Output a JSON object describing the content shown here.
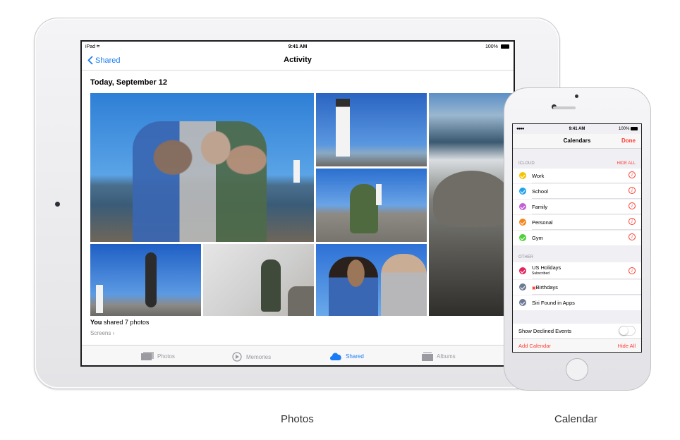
{
  "ipad": {
    "status": {
      "left": "iPad",
      "time": "9:41 AM",
      "battery": "100%"
    },
    "nav": {
      "back": "Shared",
      "title": "Activity"
    },
    "date_heading": "Today, September 12",
    "shared_bold": "You",
    "shared_rest": " shared 7 photos",
    "screens_link": "Screens",
    "tabs": [
      {
        "label": "Photos",
        "icon": "photos-icon"
      },
      {
        "label": "Memories",
        "icon": "memories-icon"
      },
      {
        "label": "Shared",
        "icon": "cloud-icon"
      },
      {
        "label": "Albums",
        "icon": "albums-icon"
      }
    ],
    "accent": "#1a7cf5"
  },
  "iphone": {
    "status": {
      "time": "9:41 AM",
      "battery": "100%"
    },
    "nav": {
      "title": "Calendars",
      "done": "Done"
    },
    "icloud": {
      "header": "ICLOUD",
      "hide_all": "HIDE ALL",
      "items": [
        {
          "label": "Work",
          "color": "#f5c400"
        },
        {
          "label": "School",
          "color": "#23a4e9"
        },
        {
          "label": "Family",
          "color": "#c25ed9"
        },
        {
          "label": "Personal",
          "color": "#f5871f"
        },
        {
          "label": "Gym",
          "color": "#4cd137"
        }
      ]
    },
    "other": {
      "header": "OTHER",
      "items": [
        {
          "label": "US Holidays",
          "sub": "Subscribed",
          "color": "#e5245f"
        },
        {
          "label": "Birthdays",
          "color": "#6c7a94"
        },
        {
          "label": "Siri Found in Apps",
          "color": "#6c7a94"
        }
      ]
    },
    "declined": "Show Declined Events",
    "add_calendar": "Add Calendar",
    "hide_all_bottom": "Hide All",
    "accent": "#ff3b30"
  },
  "captions": {
    "photos": "Photos",
    "calendar": "Calendar"
  }
}
